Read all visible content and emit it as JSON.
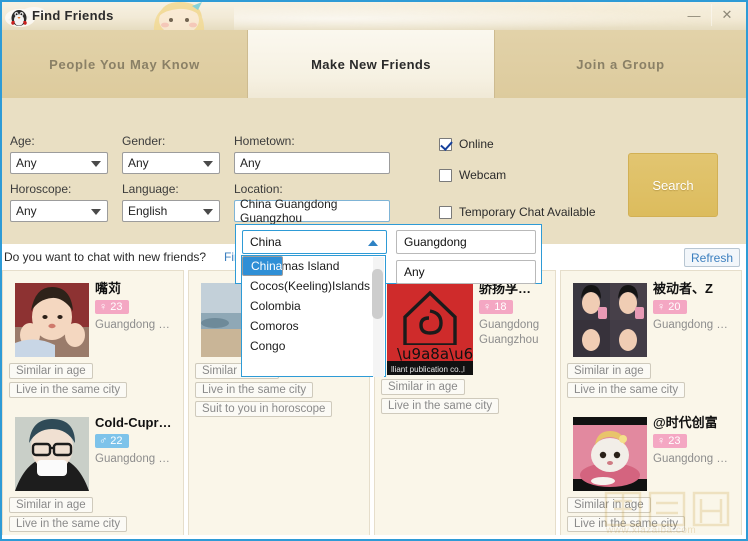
{
  "window": {
    "title": "Find Friends",
    "minimize_label": "—",
    "close_label": "✕"
  },
  "tabs": [
    {
      "label": "People You May Know",
      "active": false
    },
    {
      "label": "Make New Friends",
      "active": true
    },
    {
      "label": "Join a Group",
      "active": false
    }
  ],
  "filters": {
    "age_label": "Age:",
    "age_value": "Any",
    "gender_label": "Gender:",
    "gender_value": "Any",
    "hometown_label": "Hometown:",
    "hometown_value": "Any",
    "horoscope_label": "Horoscope:",
    "horoscope_value": "Any",
    "language_label": "Language:",
    "language_value": "English",
    "location_label": "Location:",
    "location_value": "China  Guangdong  Guangzhou",
    "online_label": "Online",
    "online_checked": true,
    "webcam_label": "Webcam",
    "webcam_checked": false,
    "temp_chat_label": "Temporary Chat Available",
    "temp_chat_checked": false,
    "search_label": "Search"
  },
  "location_picker": {
    "country_value": "China",
    "province_value": "Guangdong",
    "city_value": "Any",
    "options": [
      "China",
      "Christmas Island",
      "Cocos(Keeling)Islands",
      "Colombia",
      "Comoros",
      "Congo"
    ],
    "selected_option": "China"
  },
  "prompt": {
    "question": "Do you want to chat with new friends?",
    "find_link": "Find",
    "refresh_label": "Refresh"
  },
  "results": {
    "columns": [
      {
        "cards": [
          {
            "name": "嘴苅",
            "gender": "female",
            "gender_glyph": "♀",
            "age": "23",
            "location": "Guangdong  Guan…",
            "tags": [
              "Similar in age",
              "Live in the same city"
            ],
            "avatar": "girl-hands-on-cheeks-photo"
          },
          {
            "name": "Cold-Cupress…",
            "gender": "male",
            "gender_glyph": "♂",
            "age": "22",
            "location": "Guangdong  Guan…",
            "tags": [
              "Similar in age",
              "Live in the same city"
            ],
            "avatar": "person-glasses-mask-photo"
          }
        ]
      },
      {
        "cards": [
          {
            "name": "",
            "gender": "",
            "gender_glyph": "",
            "age": "",
            "location": "",
            "tags": [
              "Similar in age",
              "Live in the same city",
              "Suit to you in horoscope"
            ],
            "avatar": "beach-seaside-photo"
          }
        ]
      },
      {
        "cards": [
          {
            "name": "骄扬孚…",
            "gender": "female",
            "gender_glyph": "♀",
            "age": "18",
            "location": "Guangdong Guangzhou",
            "tags": [
              "Similar in age",
              "Live in the same city"
            ],
            "avatar": "red-book-logo-photo"
          }
        ]
      },
      {
        "cards": [
          {
            "name": "被动者、Z",
            "gender": "female",
            "gender_glyph": "♀",
            "age": "20",
            "location": "Guangdong  Guan…",
            "tags": [
              "Similar in age",
              "Live in the same city"
            ],
            "avatar": "girls-collage-photo"
          },
          {
            "name": "@时代创富",
            "gender": "female",
            "gender_glyph": "♀",
            "age": "23",
            "location": "Guangdong  Guan…",
            "tags": [
              "Similar in age",
              "Live in the same city"
            ],
            "avatar": "cat-in-bowl-photo"
          }
        ]
      }
    ]
  },
  "watermark": {
    "text": "www.xiazaiba.com"
  },
  "colors": {
    "accent_blue": "#2e9bd6",
    "tab_bar": "#ddcb9d",
    "filter_bg": "#e9dfc3",
    "search_button": "#dcbc5d",
    "female_badge": "#f4a7c3",
    "male_badge": "#7dc3ea",
    "link": "#3b7fbf"
  }
}
